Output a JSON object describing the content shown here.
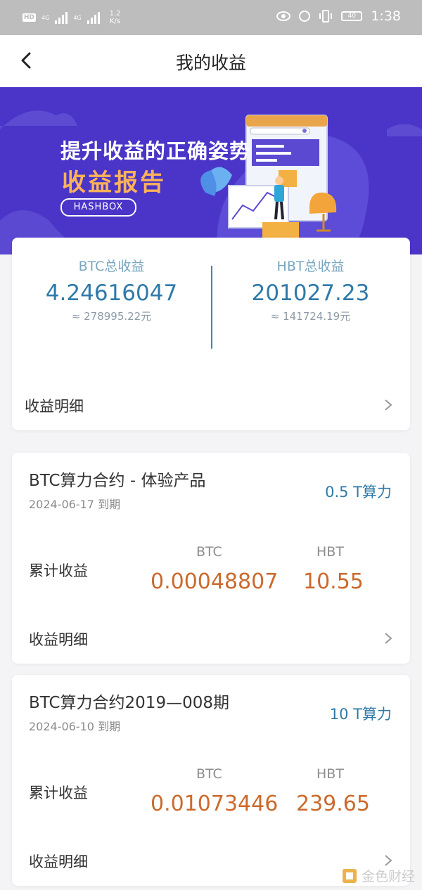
{
  "status_bar": {
    "hd": "HD",
    "net1": "4G",
    "net2": "4G",
    "speed_value": "1.2",
    "speed_unit": "K/s",
    "battery": "40",
    "time": "1:38"
  },
  "nav": {
    "title": "我的收益"
  },
  "banner": {
    "line1": "提升收益的正确姿势",
    "line2": "收益报告",
    "brand": "HASHBOX"
  },
  "summary": {
    "btc": {
      "label": "BTC总收益",
      "value": "4.24616047",
      "approx": "≈ 278995.22元"
    },
    "hbt": {
      "label": "HBT总收益",
      "value": "201027.23",
      "approx": "≈ 141724.19元"
    },
    "detail_label": "收益明细"
  },
  "contracts": [
    {
      "name": "BTC算力合约 - 体验产品",
      "date": "2024-06-17 到期",
      "power": "0.5 T算力",
      "accum_label": "累计收益",
      "btc_label": "BTC",
      "hbt_label": "HBT",
      "btc_value": "0.00048807",
      "hbt_value": "10.55",
      "detail_label": "收益明细"
    },
    {
      "name": "BTC算力合约2019—008期",
      "date": "2024-06-10 到期",
      "power": "10 T算力",
      "accum_label": "累计收益",
      "btc_label": "BTC",
      "hbt_label": "HBT",
      "btc_value": "0.01073446",
      "hbt_value": "239.65",
      "detail_label": "收益明细"
    }
  ],
  "watermark": "金色财经",
  "colors": {
    "accent": "#2f7aa9",
    "value": "#cb6a2c",
    "banner": "#4a35c8",
    "banner_accent": "#ffb25a"
  }
}
